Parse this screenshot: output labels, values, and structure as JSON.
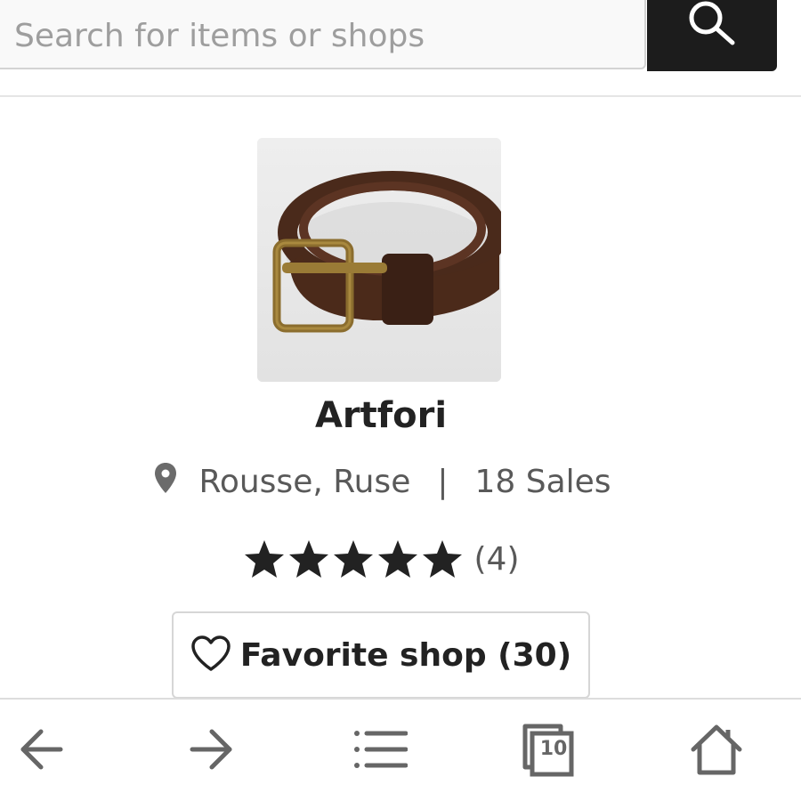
{
  "search": {
    "placeholder": "Search for items or shops",
    "icon": "search-icon"
  },
  "shop": {
    "image_alt": "Brown leather belt with brass buckle",
    "name": "Artfori",
    "location": "Rousse, Ruse",
    "separator": "|",
    "sales": "18 Sales",
    "rating": 5,
    "rating_count": "(4)",
    "favorite_label": "Favorite shop (30)"
  },
  "bottom_bar": {
    "items": [
      {
        "name": "back",
        "icon": "arrow-left-icon"
      },
      {
        "name": "forward",
        "icon": "arrow-right-icon"
      },
      {
        "name": "menu",
        "icon": "list-icon"
      },
      {
        "name": "tabs",
        "icon": "tabs-icon",
        "count": "10"
      },
      {
        "name": "home",
        "icon": "home-icon"
      }
    ]
  },
  "colors": {
    "search_button": "#1c1c1c",
    "text_primary": "#222222",
    "text_secondary": "#595959",
    "icon_gray": "#666666"
  }
}
